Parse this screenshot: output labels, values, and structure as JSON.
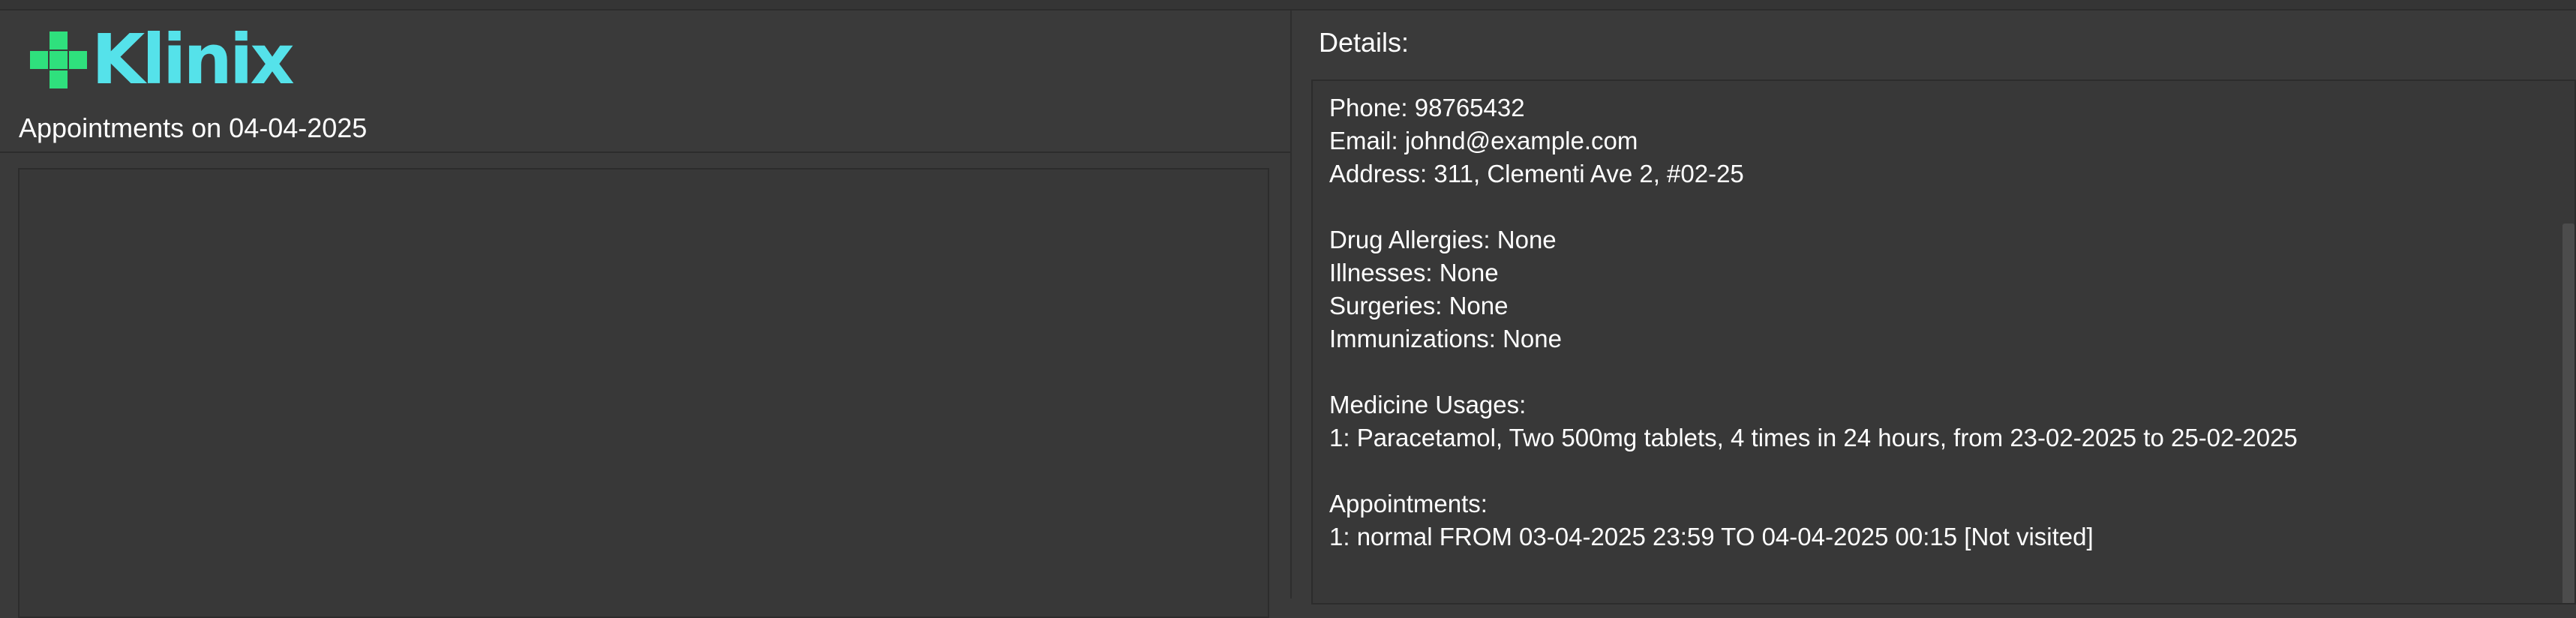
{
  "app": {
    "logo_text": "Klinix",
    "brand_colors": {
      "cross": "#2fe07d",
      "wordmark": "#55e2ea"
    }
  },
  "left_panel": {
    "appointments_header": "Appointments on 04-04-2025"
  },
  "right_panel": {
    "details_label": "Details:",
    "contact": {
      "phone": "Phone: 98765432",
      "email": "Email: johnd@example.com",
      "address": "Address: 311, Clementi Ave 2, #02-25"
    },
    "medical": {
      "drug_allergies": "Drug Allergies: None",
      "illnesses": "Illnesses: None",
      "surgeries": "Surgeries: None",
      "immunizations": "Immunizations: None"
    },
    "medicine_usages": {
      "heading": "Medicine Usages:",
      "items": [
        "1: Paracetamol, Two 500mg tablets, 4 times in 24 hours, from 23-02-2025 to 25-02-2025"
      ]
    },
    "appointments": {
      "heading": "Appointments:",
      "items": [
        "1: normal FROM 03-04-2025 23:59 TO 04-04-2025 00:15 [Not visited]"
      ]
    }
  }
}
